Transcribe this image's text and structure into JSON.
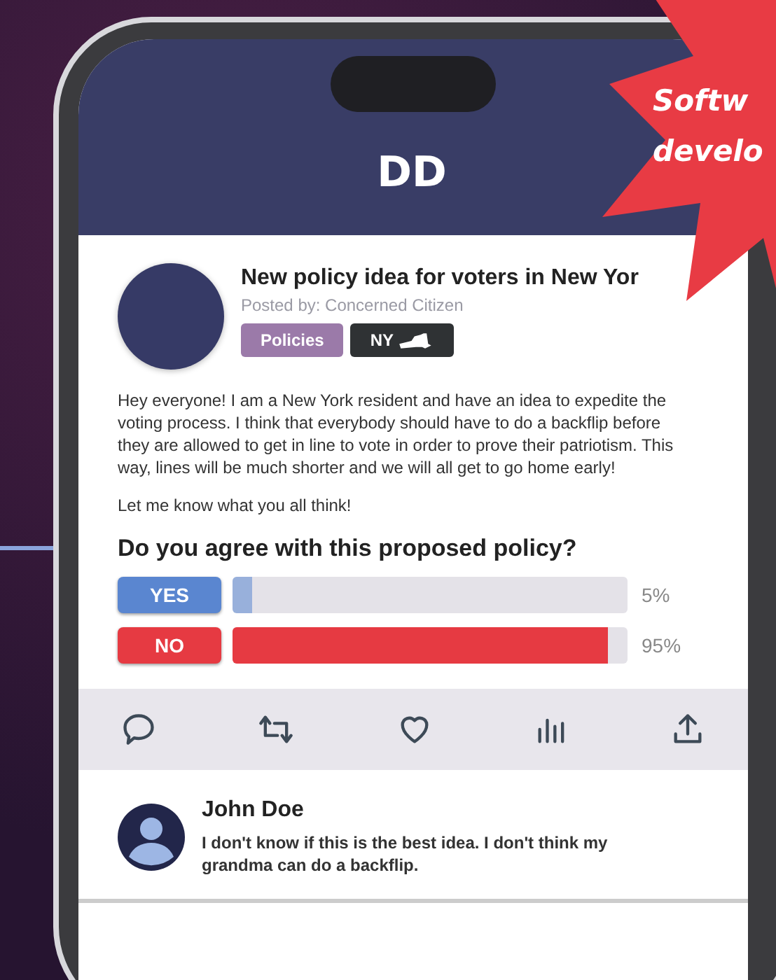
{
  "app": {
    "logo": "DD"
  },
  "post": {
    "title": "New policy idea for voters in New Yor",
    "byline": "Posted by: Concerned Citizen",
    "tags": [
      {
        "label": "Policies",
        "kind": "text",
        "color": "#9b7aa9"
      },
      {
        "label": "NY",
        "kind": "state",
        "color": "#2f3234"
      }
    ],
    "body": "Hey everyone! I am a New York resident and have an idea to expedite the voting process. I think that everybody should have to do a backflip before they are allowed to get in line to vote in order to prove their patriotism. This way, lines will be much shorter and we will all get to go home early!",
    "closing": "Let me know what you all think!"
  },
  "poll": {
    "question": "Do you agree with this proposed policy?",
    "options": [
      {
        "label": "YES",
        "color": "#5a86d0",
        "level": 0.05,
        "reading": "5%"
      },
      {
        "label": "NO",
        "color": "#e63a42",
        "level": 0.95,
        "reading": "95%"
      }
    ]
  },
  "actions": [
    {
      "kind": "comment"
    },
    {
      "kind": "repost"
    },
    {
      "kind": "like"
    },
    {
      "kind": "stats"
    },
    {
      "kind": "share"
    }
  ],
  "comments": [
    {
      "author": "John Doe",
      "text": "I don't know if this is the best idea. I don't think my grandma can do a backflip."
    }
  ],
  "burst": {
    "lines": [
      "Softw",
      "develo"
    ]
  }
}
